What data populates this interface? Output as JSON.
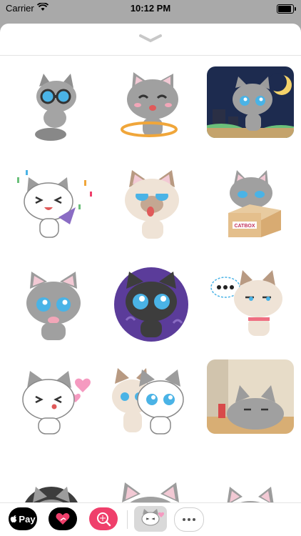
{
  "status_bar": {
    "carrier": "Carrier",
    "time": "10:12 PM"
  },
  "sheet": {
    "collapse_icon": "chevron-down-icon"
  },
  "stickers": [
    {
      "name": "sticker-cat-goggles"
    },
    {
      "name": "sticker-cat-hula-hoop"
    },
    {
      "name": "sticker-cat-night-moon"
    },
    {
      "name": "sticker-cat-party-popper"
    },
    {
      "name": "sticker-cat-tongue-out"
    },
    {
      "name": "sticker-cat-in-box",
      "box_text": "CATBOX"
    },
    {
      "name": "sticker-cat-teary-eyes"
    },
    {
      "name": "sticker-cat-dark-swirl"
    },
    {
      "name": "sticker-cat-thinking-dots"
    },
    {
      "name": "sticker-cat-blowing-hearts"
    },
    {
      "name": "sticker-cat-pair"
    },
    {
      "name": "sticker-cat-lying-room"
    },
    {
      "name": "sticker-cat-partial-1"
    },
    {
      "name": "sticker-cat-partial-2"
    },
    {
      "name": "sticker-cat-partial-3"
    }
  ],
  "drawer": {
    "apple_pay_label": "Pay",
    "apps": [
      "apple-pay-icon",
      "heart-app-icon",
      "search-app-icon",
      "current-sticker-app-icon",
      "more-icon"
    ]
  },
  "colors": {
    "sheet_bg": "#ffffff",
    "backdrop": "#a9a9a9",
    "search_app": "#ef3f6b",
    "cat_gray": "#9c9c9c",
    "cat_eye": "#4ab3e6"
  }
}
